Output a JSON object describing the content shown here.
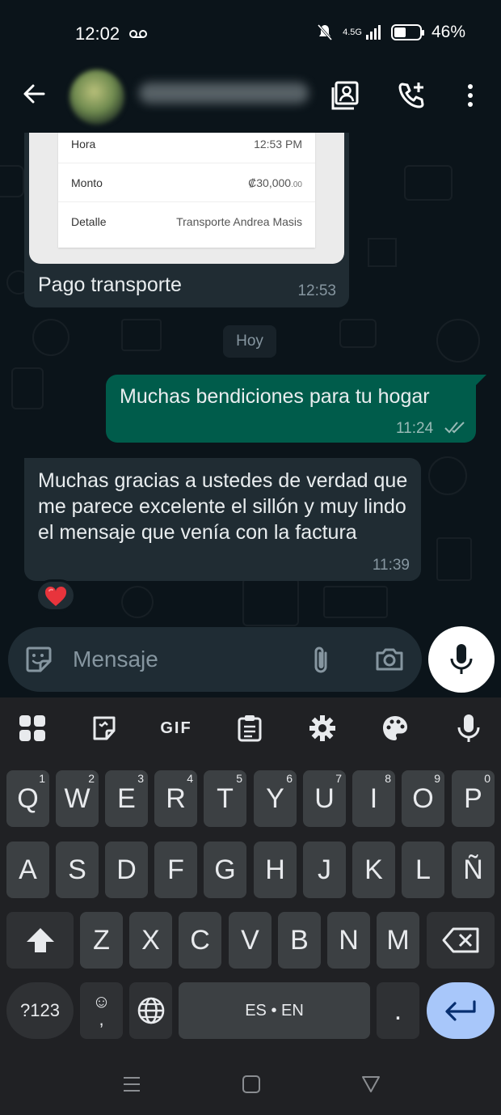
{
  "status_bar": {
    "time": "12:02",
    "network": "4.5G",
    "battery": "46%",
    "icons": [
      "voicemail-icon",
      "mute-icon",
      "signal-icon",
      "battery-icon"
    ]
  },
  "header": {
    "icons": [
      "back-arrow-icon",
      "contact-card-icon",
      "add-call-icon",
      "more-vert-icon"
    ]
  },
  "receipt": {
    "rows": [
      {
        "label": "Hora",
        "value": "12:53 PM"
      },
      {
        "label": "Monto",
        "value": "₡30,000",
        "value_cents": ".00"
      },
      {
        "label": "Detalle",
        "value": "Transporte Andrea Masis"
      }
    ],
    "caption": "Pago transporte",
    "time": "12:53"
  },
  "date_chip": "Hoy",
  "outgoing": {
    "text": "Muchas bendiciones para tu hogar",
    "time": "11:24"
  },
  "incoming": {
    "text": "Muchas gracias a ustedes de verdad que me parece excelente el sillón y muy lindo el mensaje que venía con la factura",
    "time": "11:39"
  },
  "reaction": "❤️",
  "composer": {
    "placeholder": "Mensaje",
    "icons": [
      "sticker-icon",
      "attach-icon",
      "camera-icon",
      "mic-icon"
    ]
  },
  "keyboard": {
    "toolbar": [
      "apps-grid-icon",
      "sticker-icon",
      "GIF",
      "clipboard-icon",
      "settings-icon",
      "palette-icon",
      "voice-input-icon"
    ],
    "gif_label": "GIF",
    "row1": [
      {
        "k": "Q",
        "s": "1"
      },
      {
        "k": "W",
        "s": "2"
      },
      {
        "k": "E",
        "s": "3"
      },
      {
        "k": "R",
        "s": "4"
      },
      {
        "k": "T",
        "s": "5"
      },
      {
        "k": "Y",
        "s": "6"
      },
      {
        "k": "U",
        "s": "7"
      },
      {
        "k": "I",
        "s": "8"
      },
      {
        "k": "O",
        "s": "9"
      },
      {
        "k": "P",
        "s": "0"
      }
    ],
    "row2": [
      "A",
      "S",
      "D",
      "F",
      "G",
      "H",
      "J",
      "K",
      "L",
      "Ñ"
    ],
    "row3": [
      "Z",
      "X",
      "C",
      "V",
      "B",
      "N",
      "M"
    ],
    "sym_label": "?123",
    "emoji_label": "☺",
    "comma_label": ",",
    "space_label": "ES • EN",
    "period_label": "."
  },
  "navigation": {
    "icons": [
      "recents-icon",
      "home-icon",
      "back-icon"
    ]
  },
  "colors": {
    "background": "#0b141a",
    "incoming_bubble": "#202c33",
    "outgoing_bubble": "#005c4b",
    "keyboard": "#202124",
    "key": "#3c4043",
    "enter_key": "#a8c7fa"
  }
}
